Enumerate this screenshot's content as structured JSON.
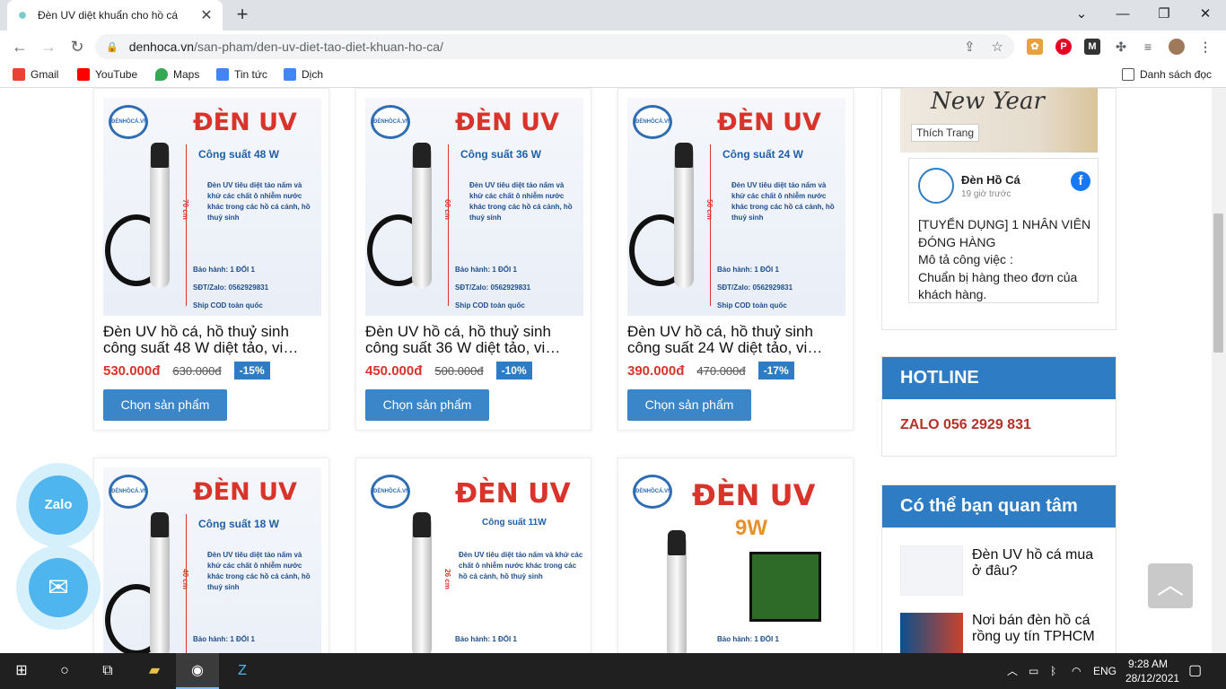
{
  "browser": {
    "tab_title": "Đèn UV diệt khuẩn cho hồ cá",
    "tab_close": "✕",
    "new_tab": "+",
    "url_host": "denhoca.vn",
    "url_path": "/san-pham/den-uv-diet-tao-diet-khuan-ho-ca/",
    "window_minimize": "⌄",
    "window_min": "—",
    "window_max": "❐",
    "window_close": "✕"
  },
  "bookmarks": [
    {
      "label": "Gmail",
      "color": "#ea4335"
    },
    {
      "label": "YouTube",
      "color": "#ff0000"
    },
    {
      "label": "Maps",
      "color": "#34a853"
    },
    {
      "label": "Tin tức",
      "color": "#4285f4"
    },
    {
      "label": "Dịch",
      "color": "#4285f4"
    }
  ],
  "reading_list": "Danh sách đọc",
  "products": [
    {
      "image_power": "Công suất 48 W",
      "image_length": "70 cm",
      "title": "Đèn UV hồ cá, hồ thuỷ sinh công suất 48 W diệt tảo, vi…",
      "price": "530.000đ",
      "old_price": "630.000đ",
      "discount": "-15%",
      "button": "Chọn sản phẩm"
    },
    {
      "image_power": "Công suất 36 W",
      "image_length": "60 cm",
      "title": "Đèn UV hồ cá, hồ thuỷ sinh công suất 36 W diệt tảo, vi…",
      "price": "450.000đ",
      "old_price": "500.000đ",
      "discount": "-10%",
      "button": "Chọn sản phẩm"
    },
    {
      "image_power": "Công suất 24 W",
      "image_length": "50 cm",
      "title": "Đèn UV hồ cá, hồ thuỷ sinh công suất 24 W diệt tảo, vi…",
      "price": "390.000đ",
      "old_price": "470.000đ",
      "discount": "-17%",
      "button": "Chọn sản phẩm"
    },
    {
      "image_power": "Công suất 18 W",
      "image_length": "40 cm"
    },
    {
      "image_power": "Công suất 11W",
      "image_length": "26 cm"
    },
    {
      "image_power": "9W",
      "image_length": ""
    }
  ],
  "image_text": {
    "heading": "ĐÈN UV",
    "desc": "Đèn UV tiêu diệt tảo nấm và khử các chất ô nhiễm nước khác trong các hồ cá cảnh, hồ thuỷ sinh",
    "warranty": "Bảo hành: 1 ĐỔI 1",
    "phone": "SĐT/Zalo: 0562929831",
    "ship": "Ship COD toàn quốc",
    "brand": "ĐÈNHỒCÁ.VN"
  },
  "facebook": {
    "banner_text": "New Year",
    "like_label": "Thích Trang",
    "page_name": "Đèn Hồ Cá",
    "time": "19 giờ trước",
    "post_text": "[TUYỂN DỤNG] 1 NHÂN VIÊN ĐÓNG HÀNG\nMô tả công việc :\nChuẩn bị hàng theo đơn của khách hàng."
  },
  "hotline": {
    "heading": "HOTLINE",
    "number": "ZALO 056 2929 831"
  },
  "related": {
    "heading": "Có thể bạn quan tâm",
    "items": [
      "Đèn UV hồ cá mua ở đâu?",
      "Nơi bán đèn hồ cá rồng uy tín TPHCM"
    ]
  },
  "floating": {
    "zalo": "Zalo",
    "messenger": "✉",
    "to_top": "︿"
  },
  "taskbar": {
    "lang": "ENG",
    "time": "9:28 AM",
    "date": "28/12/2021"
  },
  "colors": {
    "accent": "#2d7cc4",
    "price": "#d9342b"
  }
}
